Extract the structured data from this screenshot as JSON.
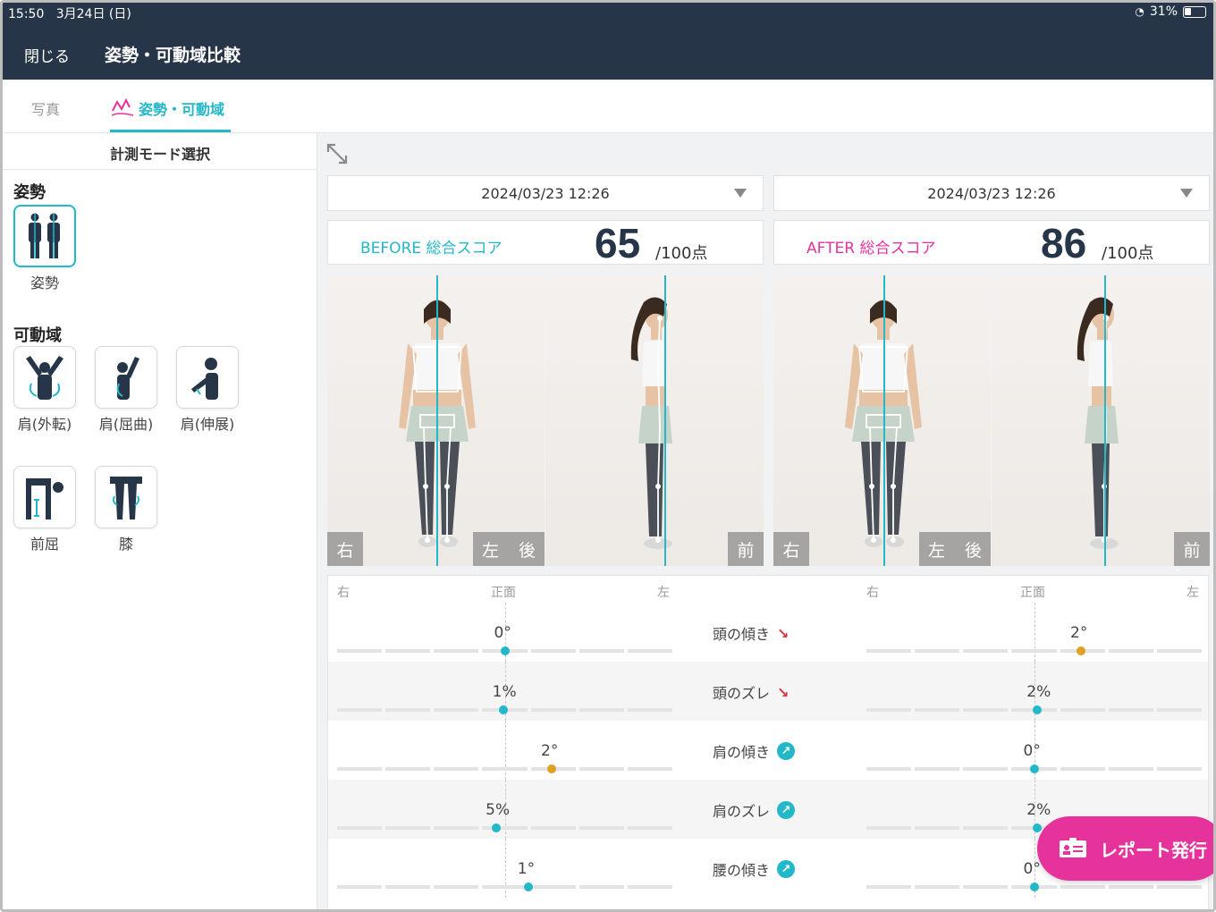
{
  "status": {
    "time": "15:50",
    "date": "3月24日 (日)",
    "battery": "31%"
  },
  "header": {
    "close_label": "閉じる",
    "title": "姿勢・可動域比較"
  },
  "tabs": [
    {
      "label": "写真"
    },
    {
      "label": "姿勢・可動域"
    }
  ],
  "sidebar": {
    "mode_title": "計測モード選択",
    "posture_section": "姿勢",
    "posture_item": "姿勢",
    "rom_section": "可動域",
    "rom_items": [
      {
        "label": "肩(外転)"
      },
      {
        "label": "肩(屈曲)"
      },
      {
        "label": "肩(伸展)"
      },
      {
        "label": "前屈"
      },
      {
        "label": "膝"
      }
    ]
  },
  "compare": {
    "before": {
      "date": "2024/03/23 12:26",
      "score_label": "BEFORE 総合スコア",
      "score": "65",
      "score_max": "/100点",
      "labels": {
        "right": "右",
        "left": "左",
        "back": "後",
        "front": "前"
      }
    },
    "after": {
      "date": "2024/03/23 12:26",
      "score_label": "AFTER 総合スコア",
      "score": "86",
      "score_max": "/100点",
      "labels": {
        "right": "右",
        "left": "左",
        "back": "後",
        "front": "前"
      }
    }
  },
  "table": {
    "axis": {
      "right": "右",
      "center": "正面",
      "left": "左"
    },
    "rows": [
      {
        "label": "頭の傾き",
        "before": "0°",
        "after": "2°",
        "before_pos": 0.5,
        "after_pos": 0.64,
        "before_color": "#23b8c9",
        "after_color": "#e0a020",
        "trend": "down"
      },
      {
        "label": "頭のズレ",
        "before": "1%",
        "after": "2%",
        "before_pos": 0.495,
        "after_pos": 0.51,
        "before_color": "#23b8c9",
        "after_color": "#23b8c9",
        "trend": "down"
      },
      {
        "label": "肩の傾き",
        "before": "2°",
        "after": "0°",
        "before_pos": 0.64,
        "after_pos": 0.5,
        "before_color": "#e0a020",
        "after_color": "#23b8c9",
        "trend": "up"
      },
      {
        "label": "肩のズレ",
        "before": "5%",
        "after": "2%",
        "before_pos": 0.475,
        "after_pos": 0.51,
        "before_color": "#23b8c9",
        "after_color": "#23b8c9",
        "trend": "up"
      },
      {
        "label": "腰の傾き",
        "before": "1°",
        "after": "0°",
        "before_pos": 0.57,
        "after_pos": 0.5,
        "before_color": "#23b8c9",
        "after_color": "#23b8c9",
        "trend": "up"
      }
    ]
  },
  "report_button": "レポート発行",
  "colors": {
    "accent": "#23b8c9",
    "header": "#263648",
    "pink": "#e6329b",
    "warn": "#e0a020"
  }
}
